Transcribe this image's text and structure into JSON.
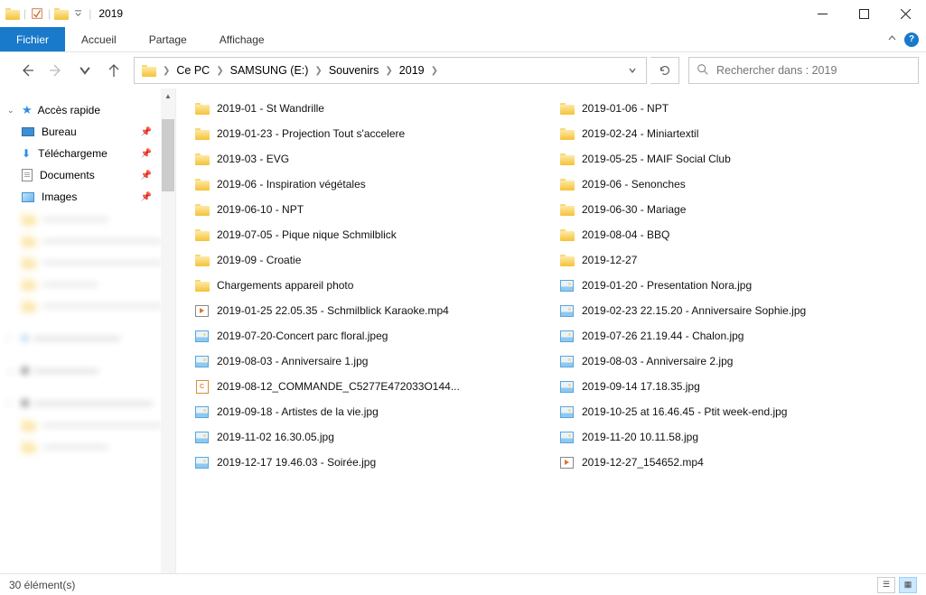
{
  "window": {
    "title": "2019"
  },
  "ribbon": {
    "file": "Fichier",
    "home": "Accueil",
    "share": "Partage",
    "view": "Affichage"
  },
  "breadcrumbs": [
    "Ce PC",
    "SAMSUNG (E:)",
    "Souvenirs",
    "2019"
  ],
  "search": {
    "placeholder": "Rechercher dans : 2019"
  },
  "sidebar": {
    "quick_access": "Accès rapide",
    "desktop": "Bureau",
    "downloads": "Téléchargeme",
    "documents": "Documents",
    "images": "Images"
  },
  "folders_col1": [
    "2019-01 - St Wandrille",
    "2019-01-23 - Projection Tout s'accelere",
    "2019-03 - EVG",
    "2019-06 - Inspiration végétales",
    "2019-06-10 - NPT",
    "2019-07-05 - Pique nique Schmilblick",
    "2019-09 - Croatie",
    "Chargements appareil photo"
  ],
  "folders_col2": [
    "2019-01-06 - NPT",
    "2019-02-24 - Miniartextil",
    "2019-05-25 - MAIF Social Club",
    "2019-06 - Senonches",
    "2019-06-30 - Mariage",
    "2019-08-04 - BBQ",
    "2019-12-27"
  ],
  "files_col1": [
    {
      "t": "mov",
      "n": "2019-01-25 22.05.35 - Schmilblick Karaoke.mp4"
    },
    {
      "t": "img",
      "n": "2019-07-20-Concert parc floral.jpeg"
    },
    {
      "t": "img",
      "n": "2019-08-03 - Anniversaire 1.jpg"
    },
    {
      "t": "pdf",
      "n": "2019-08-12_COMMANDE_C5277E472033O144..."
    },
    {
      "t": "img",
      "n": "2019-09-18 - Artistes de la vie.jpg"
    },
    {
      "t": "img",
      "n": "2019-11-02 16.30.05.jpg"
    },
    {
      "t": "img",
      "n": "2019-12-17 19.46.03 - Soirée.jpg"
    }
  ],
  "files_col2": [
    {
      "t": "img",
      "n": "2019-01-20 - Presentation Nora.jpg"
    },
    {
      "t": "img",
      "n": "2019-02-23 22.15.20 - Anniversaire Sophie.jpg"
    },
    {
      "t": "img",
      "n": "2019-07-26 21.19.44 - Chalon.jpg"
    },
    {
      "t": "img",
      "n": "2019-08-03 - Anniversaire 2.jpg"
    },
    {
      "t": "img",
      "n": "2019-09-14 17.18.35.jpg"
    },
    {
      "t": "img",
      "n": "2019-10-25 at 16.46.45 - Ptit week-end.jpg"
    },
    {
      "t": "img",
      "n": "2019-11-20 10.11.58.jpg"
    },
    {
      "t": "mov",
      "n": "2019-12-27_154652.mp4"
    }
  ],
  "status": {
    "count": "30 élément(s)"
  }
}
